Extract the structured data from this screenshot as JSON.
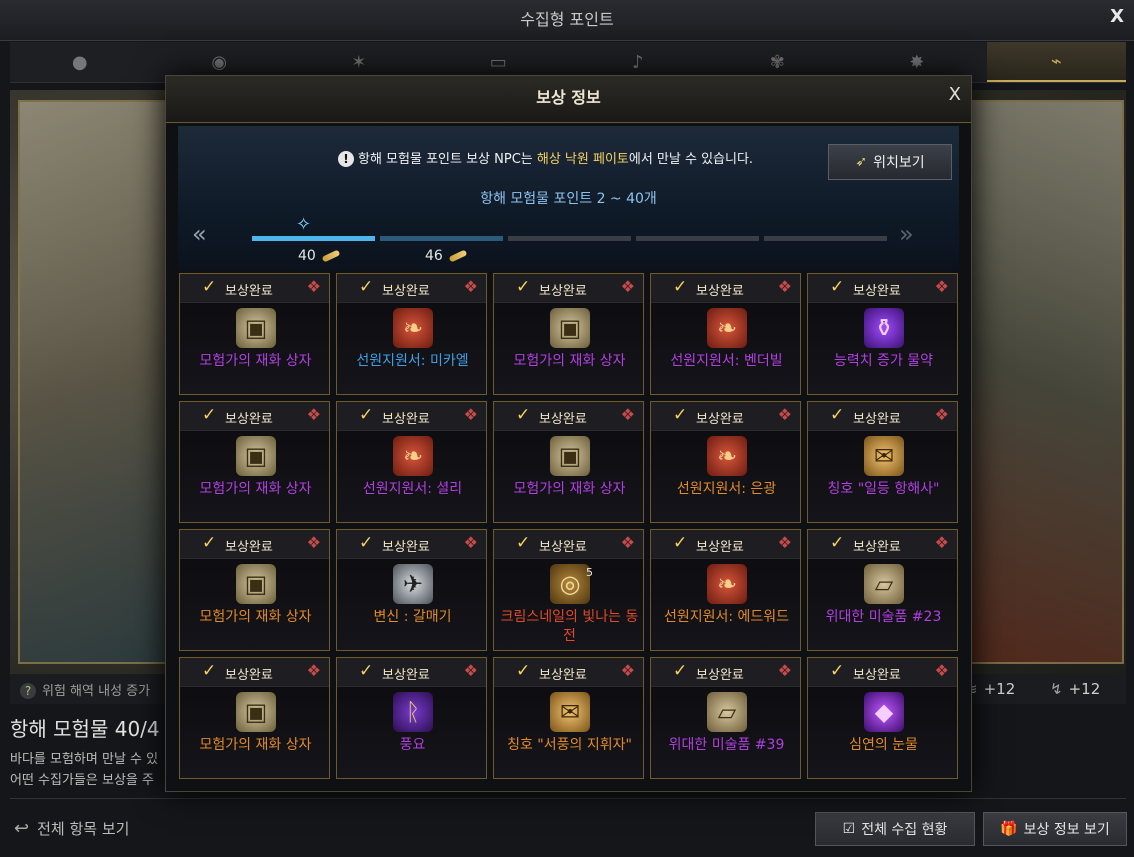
{
  "window": {
    "title": "수집형 포인트",
    "close": "X"
  },
  "tabs": [
    {
      "icon": "orb",
      "glyph": "●"
    },
    {
      "icon": "orb-silver",
      "glyph": "◉"
    },
    {
      "icon": "star-burst",
      "glyph": "✶"
    },
    {
      "icon": "painting",
      "glyph": "▭"
    },
    {
      "icon": "seed",
      "glyph": "♪"
    },
    {
      "icon": "emblem",
      "glyph": "✾"
    },
    {
      "icon": "leaf",
      "glyph": "✸"
    },
    {
      "icon": "telescope",
      "glyph": "⌁"
    }
  ],
  "stats": {
    "left_label": "위험 해역 내성 증가",
    "right1": "+12",
    "right2": "+12"
  },
  "main": {
    "title": "항해 모험물 40/4",
    "desc1": "바다를 모험하며 만날 수 있",
    "desc2": "어떤 수집가들은 보상을 주"
  },
  "bottom": {
    "back": "전체 항목 보기",
    "status_btn": "전체 수집 현황",
    "reward_btn": "보상 정보 보기"
  },
  "modal": {
    "title": "보상 정보",
    "close": "X",
    "notice_pre": "항해 모험물 포인트 보상 NPC는 ",
    "notice_hl": "해상 낙원 페이토",
    "notice_post": "에서 만날 수 있습니다.",
    "location_btn": "위치보기",
    "range": "항해 모험물 포인트 2 ~ 40개",
    "progress": {
      "current": "40",
      "next": "46",
      "fill_segments": [
        1.0,
        0.4,
        0,
        0,
        0
      ]
    },
    "done_label": "보상완료",
    "rewards": [
      {
        "name": "모험가의 재화 상자",
        "icon": "chest",
        "color": "purple"
      },
      {
        "name": "선원지원서: 미카엘",
        "icon": "book",
        "color": "blue"
      },
      {
        "name": "모험가의 재화 상자",
        "icon": "chest",
        "color": "purple"
      },
      {
        "name": "선원지원서: 벤더빌",
        "icon": "book",
        "color": "purple"
      },
      {
        "name": "능력치 증가 물약",
        "icon": "potion",
        "color": "purple"
      },
      {
        "name": "모험가의 재화 상자",
        "icon": "chest",
        "color": "purple"
      },
      {
        "name": "선원지원서: 셜리",
        "icon": "book",
        "color": "purple"
      },
      {
        "name": "모험가의 재화 상자",
        "icon": "chest",
        "color": "purple"
      },
      {
        "name": "선원지원서: 은광",
        "icon": "book",
        "color": "orange"
      },
      {
        "name": "칭호 \"일등 항해사\"",
        "icon": "scroll",
        "color": "purple"
      },
      {
        "name": "모험가의 재화 상자",
        "icon": "chest",
        "color": "orange"
      },
      {
        "name": "변신 : 갈매기",
        "icon": "gull",
        "color": "orange"
      },
      {
        "name": "크림스네일의 빛나는 동전",
        "icon": "coin",
        "color": "red",
        "qty": "5"
      },
      {
        "name": "선원지원서: 에드워드",
        "icon": "book",
        "color": "orange"
      },
      {
        "name": "위대한 미술품 #23",
        "icon": "map",
        "color": "purple"
      },
      {
        "name": "모험가의 재화 상자",
        "icon": "chest",
        "color": "orange"
      },
      {
        "name": "풍요",
        "icon": "rune",
        "color": "purple"
      },
      {
        "name": "칭호 \"서풍의 지휘자\"",
        "icon": "scroll",
        "color": "orange"
      },
      {
        "name": "위대한 미술품 #39",
        "icon": "map",
        "color": "purple"
      },
      {
        "name": "심연의 눈물",
        "icon": "gem",
        "color": "orange"
      }
    ]
  }
}
